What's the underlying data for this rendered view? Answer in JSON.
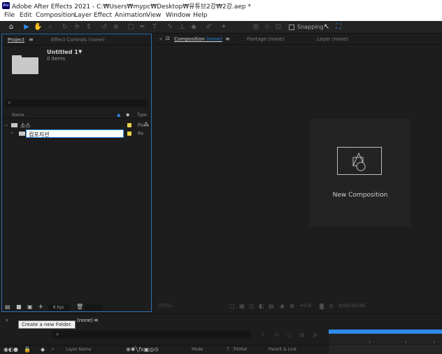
{
  "app": {
    "icon_text": "Ae",
    "title": "Adobe After Effects 2021 - C:₩Users₩mypc₩Desktop₩유튜브2강₩2강.aep *"
  },
  "menu": [
    "File",
    "Edit",
    "Composition",
    "Layer",
    "Effect",
    "Animation",
    "View",
    "Window",
    "Help"
  ],
  "toolbar": {
    "snapping_label": "Snapping"
  },
  "project_panel": {
    "tab_label": "Project",
    "effect_controls_label": "Effect Controls (none)",
    "item_title": "Untitled 1",
    "item_count": "0 items",
    "search_icon": "search-icon",
    "col_name": "Name",
    "col_type": "Type",
    "rows": [
      {
        "name": "소스",
        "type": "Fo"
      },
      {
        "name": "컴포지션",
        "type": "Fo"
      }
    ],
    "bpc_label": "8 bpc"
  },
  "viewer": {
    "comp_tab_prefix": "Composition",
    "comp_tab_value": "(none)",
    "footage_tab": "Footage (none)",
    "layer_tab": "Layer (none)",
    "new_comp_label": "New Composition",
    "zoom": "(50%)",
    "resolution": "(Full)",
    "timecode": "0;00;00;00",
    "exposure": "+0.0"
  },
  "timeline": {
    "tab_partial": "(none)",
    "tooltip": "Create a new Folder.",
    "col_layer_name": "Layer Name",
    "col_mode": "Mode",
    "col_trkmat": "T  .TrkMat",
    "col_parent": "Parent & Link"
  }
}
